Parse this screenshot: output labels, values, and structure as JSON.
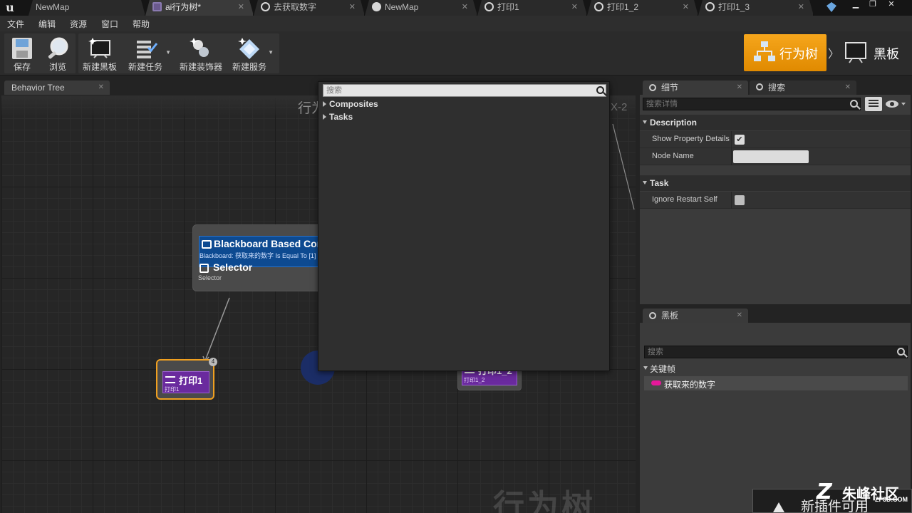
{
  "tabs": [
    {
      "label": "NewMap",
      "icon": "ue-logo-icon",
      "active": false
    },
    {
      "label": "ai行为树*",
      "icon": "behavior-tree-icon",
      "active": true
    },
    {
      "label": "去获取数字",
      "icon": "blueprint-icon",
      "active": false
    },
    {
      "label": "NewMap",
      "icon": "level-icon",
      "active": false
    },
    {
      "label": "打印1",
      "icon": "blueprint-icon",
      "active": false
    },
    {
      "label": "打印1_2",
      "icon": "blueprint-icon",
      "active": false
    },
    {
      "label": "打印1_3",
      "icon": "blueprint-icon",
      "active": false
    }
  ],
  "menu": [
    "文件",
    "编辑",
    "资源",
    "窗口",
    "帮助"
  ],
  "toolbar": {
    "buttons": [
      "保存",
      "浏览",
      "新建黑板",
      "新建任务",
      "新建装饰器",
      "新建服务"
    ],
    "modes": {
      "behavior_tree": "行为树",
      "blackboard": "黑板",
      "separator": "〉"
    }
  },
  "graph": {
    "tab_label": "Behavior Tree",
    "title": "行为",
    "right_tag": "X-2",
    "watermark": "行为树",
    "composite": {
      "decorator_title": "Blackboard Based Condition",
      "decorator_sub": "Blackboard: 获取来的数字 Is Equal To [1]",
      "title": "Selector",
      "subtitle": "Selector"
    },
    "task1": {
      "title": "打印1",
      "subtitle": "打印1",
      "badge": "4"
    },
    "task2": {
      "title": "打印1_2",
      "subtitle": "打印1_2"
    }
  },
  "popup": {
    "search_placeholder": "搜索",
    "categories": [
      "Composites",
      "Tasks"
    ]
  },
  "details": {
    "tab_label": "细节",
    "search_tab_label": "搜索",
    "search_placeholder": "搜索详情",
    "sections": [
      {
        "title": "Description",
        "rows": [
          {
            "label": "Show Property Details",
            "type": "checkbox",
            "checked": true
          },
          {
            "label": "Node Name",
            "type": "text",
            "value": ""
          }
        ]
      },
      {
        "title": "Task",
        "rows": [
          {
            "label": "Ignore Restart Self",
            "type": "checkbox",
            "checked": false
          }
        ]
      }
    ]
  },
  "blackboard": {
    "tab_label": "黑板",
    "search_placeholder": "搜索",
    "category": "关键帧",
    "keys": [
      {
        "name": "获取来的数字",
        "color": "#e5189a"
      }
    ]
  },
  "notification": {
    "text": "新插件可用"
  },
  "site_logo": {
    "mark": "Z",
    "name": "朱峰社区",
    "domain": "ZF3D.COM"
  }
}
